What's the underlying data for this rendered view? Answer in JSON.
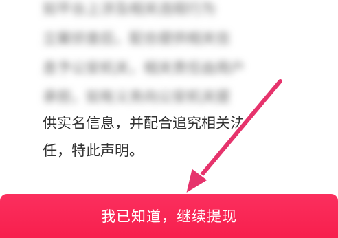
{
  "dialog": {
    "body_lines": [
      "如平台上涉及相关违规行为",
      "立案侦查后，配合提供相关信",
      "息予公安机关，相关责任由用户",
      "承担，如有义务向公安机关提",
      "供实名信息，并配合追究相关法",
      "任，特此声明。"
    ]
  },
  "confirm_button": {
    "label": "我已知道，继续提现"
  },
  "annotation": {
    "arrow_color": "#e6336c",
    "icon": "arrow-down-left-icon"
  }
}
